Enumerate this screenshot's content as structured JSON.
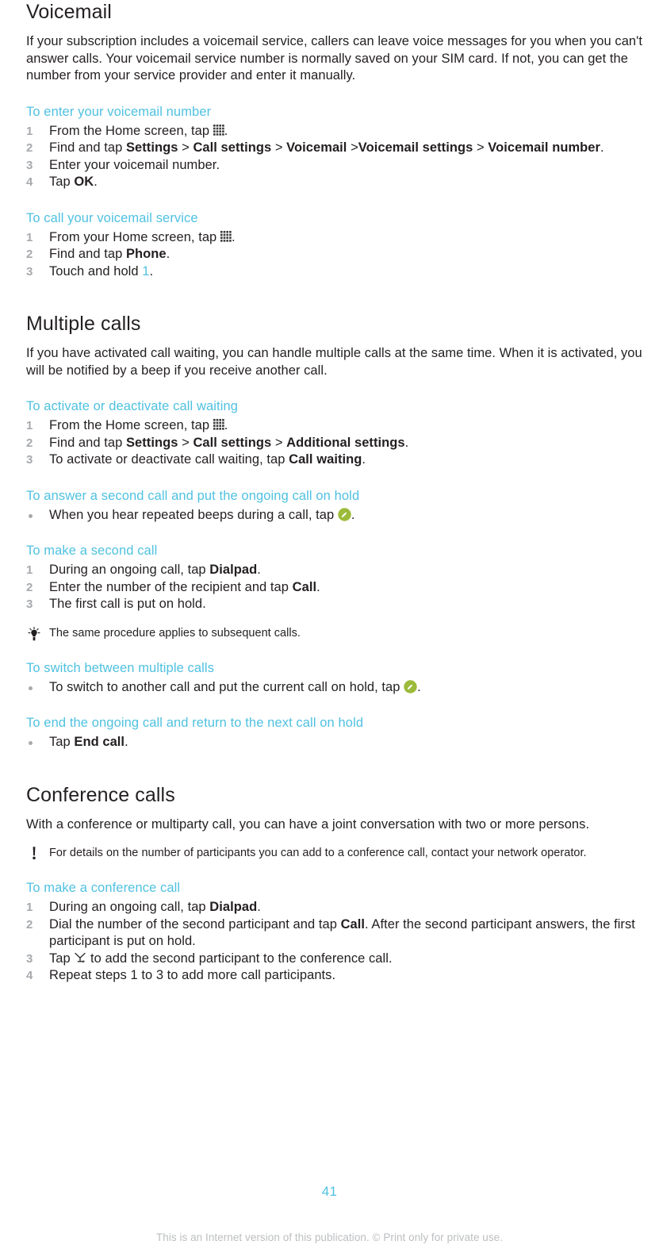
{
  "page": {
    "number": "41",
    "imprint": "This is an Internet version of this publication. © Print only for private use.",
    "accent_color": "#4fc1e0",
    "text_color": "#231f20",
    "muted_color": "#a7a9ac",
    "call_icon_color": "#9cbb3a"
  },
  "sections": {
    "voicemail": {
      "title": "Voicemail",
      "intro": "If your subscription includes a voicemail service, callers can leave voice messages for you when you can't answer calls. Your voicemail service number is normally saved on your SIM card. If not, you can get the number from your service provider and enter it manually.",
      "task_enter_number": {
        "heading": "To enter your voicemail number",
        "steps": [
          {
            "num": "1",
            "pre": "From the Home screen, tap ",
            "icon": "app-drawer-icon",
            "post": "."
          },
          {
            "num": "2",
            "pre": "Find and tap ",
            "bold1": "Settings",
            "sep1": " > ",
            "bold2": "Call settings",
            "sep2": " > ",
            "bold3": "Voicemail",
            "sep3": " >",
            "bold4": "Voicemail settings",
            "sep4": " > ",
            "bold5": "Voicemail number",
            "post": "."
          },
          {
            "num": "3",
            "pre": "Enter your voicemail number."
          },
          {
            "num": "4",
            "pre": "Tap ",
            "bold1": "OK",
            "post": "."
          }
        ]
      },
      "task_call_service": {
        "heading": "To call your voicemail service",
        "steps": [
          {
            "num": "1",
            "pre": "From your Home screen, tap ",
            "icon": "app-drawer-icon",
            "post": "."
          },
          {
            "num": "2",
            "pre": "Find and tap ",
            "bold1": "Phone",
            "post": "."
          },
          {
            "num": "3",
            "pre": "Touch and hold ",
            "accent1": "1",
            "post": "."
          }
        ]
      }
    },
    "multiple_calls": {
      "title": "Multiple calls",
      "intro": "If you have activated call waiting, you can handle multiple calls at the same time. When it is activated, you will be notified by a beep if you receive another call.",
      "task_call_waiting": {
        "heading": "To activate or deactivate call waiting",
        "steps": [
          {
            "num": "1",
            "pre": "From the Home screen, tap ",
            "icon": "app-drawer-icon",
            "post": "."
          },
          {
            "num": "2",
            "pre": "Find and tap ",
            "bold1": "Settings",
            "sep1": " > ",
            "bold2": "Call settings",
            "sep2": " > ",
            "bold3": "Additional settings",
            "post": "."
          },
          {
            "num": "3",
            "pre": "To activate or deactivate call waiting, tap ",
            "bold1": "Call waiting",
            "post": "."
          }
        ]
      },
      "task_answer_second": {
        "heading": "To answer a second call and put the ongoing call on hold",
        "bullets": [
          {
            "pre": "When you hear repeated beeps during a call, tap ",
            "icon": "answer-call-icon",
            "post": "."
          }
        ]
      },
      "task_make_second": {
        "heading": "To make a second call",
        "steps": [
          {
            "num": "1",
            "pre": "During an ongoing call, tap ",
            "bold1": "Dialpad",
            "post": "."
          },
          {
            "num": "2",
            "pre": "Enter the number of the recipient and tap ",
            "bold1": "Call",
            "post": "."
          },
          {
            "num": "3",
            "pre": "The first call is put on hold."
          }
        ],
        "tip": {
          "icon": "tip-lightbulb-icon",
          "text": "The same procedure applies to subsequent calls."
        }
      },
      "task_switch": {
        "heading": "To switch between multiple calls",
        "bullets": [
          {
            "pre": "To switch to another call and put the current call on hold, tap ",
            "icon": "answer-call-icon",
            "post": "."
          }
        ]
      },
      "task_end_ongoing": {
        "heading": "To end the ongoing call and return to the next call on hold",
        "bullets": [
          {
            "pre": "Tap ",
            "bold1": "End call",
            "post": "."
          }
        ]
      }
    },
    "conference_calls": {
      "title": "Conference calls",
      "intro": "With a conference or multiparty call, you can have a joint conversation with two or more persons.",
      "note": {
        "icon": "note-exclamation-icon",
        "text": "For details on the number of participants you can add to a conference call, contact your network operator."
      },
      "task_make_conference": {
        "heading": "To make a conference call",
        "steps": [
          {
            "num": "1",
            "pre": "During an ongoing call, tap ",
            "bold1": "Dialpad",
            "post": "."
          },
          {
            "num": "2",
            "pre": "Dial the number of the second participant and tap ",
            "bold1": "Call",
            "post": ". After the second participant answers, the first participant is put on hold."
          },
          {
            "num": "3",
            "pre": "Tap ",
            "icon": "merge-calls-icon",
            "post": " to add the second participant to the conference call."
          },
          {
            "num": "4",
            "pre": "Repeat steps 1 to 3 to add more call participants."
          }
        ]
      }
    }
  }
}
